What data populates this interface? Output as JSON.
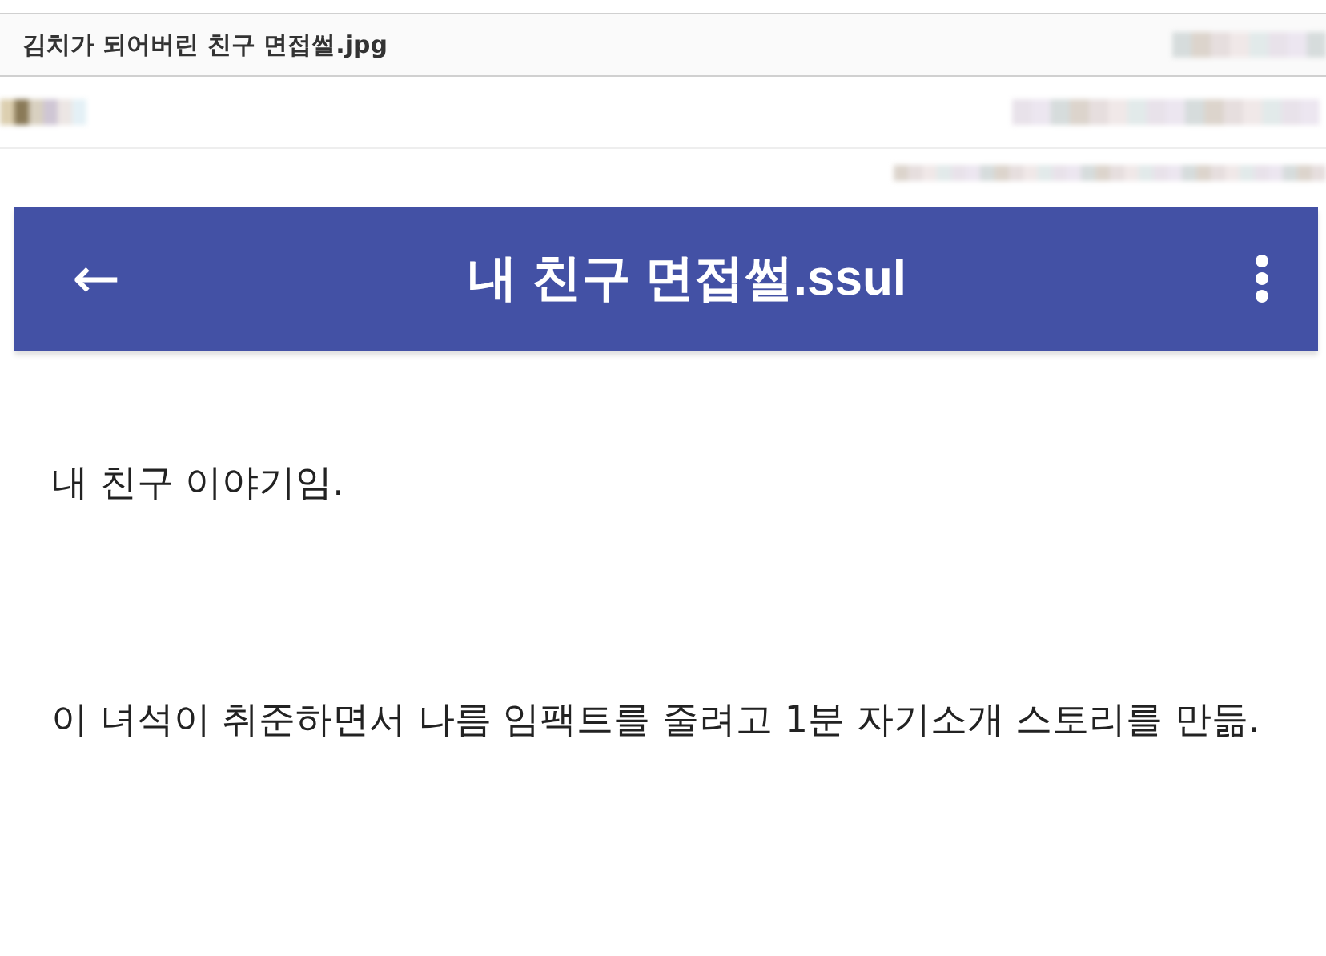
{
  "post": {
    "title": "김치가 되어버린 친구 면접썰.jpg"
  },
  "image": {
    "app_bar": {
      "back": "←",
      "title": "내 친구 면접썰.ssul"
    },
    "paragraphs": [
      "내 친구 이야기임.",
      "이 녀석이 취준하면서 나름 임팩트를 줄려고 1분 자기소개 스토리를 만듦."
    ]
  }
}
